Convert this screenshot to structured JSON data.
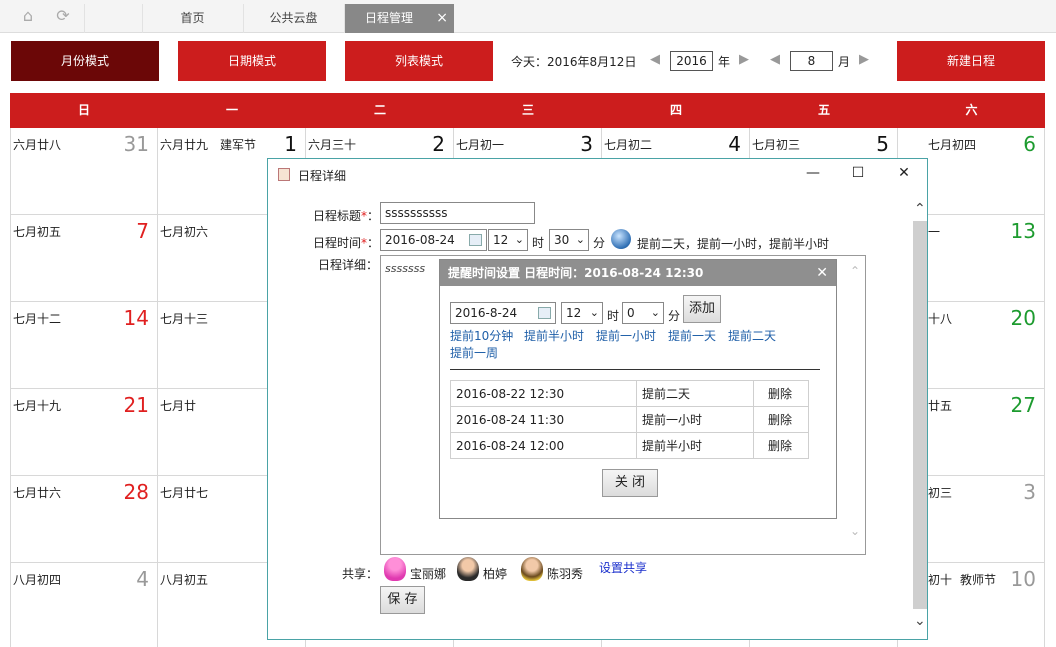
{
  "tabs": {
    "home": "首页",
    "cloud": "公共云盘",
    "schedule": "日程管理",
    "close": "×"
  },
  "toolbar": {
    "month_mode": "月份模式",
    "date_mode": "日期模式",
    "list_mode": "列表模式",
    "today": "今天：2016年8月12日",
    "year": "2016",
    "year_unit": "年",
    "month": "8",
    "month_unit": "月",
    "new_schedule": "新建日程",
    "prev": "◀",
    "next": "▶"
  },
  "colors": {
    "accent": "#cc1d1d",
    "accent_dark": "#6b0707",
    "weekend_sun": "#e02020",
    "weekend_sat": "#1d9b2f"
  },
  "weekdays": [
    "日",
    "一",
    "二",
    "三",
    "四",
    "五",
    "六"
  ],
  "calendar": {
    "rows": [
      [
        {
          "lunar": "六月廿八",
          "day": "31",
          "fest": "",
          "tone": "gray"
        },
        {
          "lunar": "六月廿九",
          "day": "1",
          "fest": "建军节",
          "tone": "normal"
        },
        {
          "lunar": "六月三十",
          "day": "2",
          "fest": "",
          "tone": "normal"
        },
        {
          "lunar": "七月初一",
          "day": "3",
          "fest": "",
          "tone": "normal"
        },
        {
          "lunar": "七月初二",
          "day": "4",
          "fest": "",
          "tone": "normal"
        },
        {
          "lunar": "七月初三",
          "day": "5",
          "fest": "",
          "tone": "normal"
        },
        {
          "lunar": "七月初四",
          "day": "6",
          "fest": "",
          "tone": "green"
        }
      ],
      [
        {
          "lunar": "七月初五",
          "day": "7",
          "fest": "",
          "tone": "red"
        },
        {
          "lunar": "七月初六",
          "day": "",
          "fest": "",
          "tone": "normal"
        },
        {
          "lunar": "",
          "day": "",
          "fest": "",
          "tone": "normal"
        },
        {
          "lunar": "",
          "day": "",
          "fest": "",
          "tone": "normal"
        },
        {
          "lunar": "",
          "day": "",
          "fest": "",
          "tone": "normal"
        },
        {
          "lunar": "",
          "day": "",
          "fest": "",
          "tone": "normal"
        },
        {
          "lunar": "一",
          "day": "13",
          "fest": "",
          "tone": "green"
        }
      ],
      [
        {
          "lunar": "七月十二",
          "day": "14",
          "fest": "",
          "tone": "red"
        },
        {
          "lunar": "七月十三",
          "day": "",
          "fest": "",
          "tone": "normal"
        },
        {
          "lunar": "",
          "day": "",
          "fest": "",
          "tone": "normal"
        },
        {
          "lunar": "",
          "day": "",
          "fest": "",
          "tone": "normal"
        },
        {
          "lunar": "",
          "day": "",
          "fest": "",
          "tone": "normal"
        },
        {
          "lunar": "",
          "day": "",
          "fest": "",
          "tone": "normal"
        },
        {
          "lunar": "十八",
          "day": "20",
          "fest": "",
          "tone": "green"
        }
      ],
      [
        {
          "lunar": "七月十九",
          "day": "21",
          "fest": "",
          "tone": "red"
        },
        {
          "lunar": "七月廿",
          "day": "",
          "fest": "",
          "tone": "normal"
        },
        {
          "lunar": "",
          "day": "",
          "fest": "",
          "tone": "normal"
        },
        {
          "lunar": "",
          "day": "",
          "fest": "",
          "tone": "normal"
        },
        {
          "lunar": "",
          "day": "",
          "fest": "",
          "tone": "normal"
        },
        {
          "lunar": "",
          "day": "",
          "fest": "",
          "tone": "normal"
        },
        {
          "lunar": "廿五",
          "day": "27",
          "fest": "",
          "tone": "green"
        }
      ],
      [
        {
          "lunar": "七月廿六",
          "day": "28",
          "fest": "",
          "tone": "red"
        },
        {
          "lunar": "七月廿七",
          "day": "",
          "fest": "",
          "tone": "normal"
        },
        {
          "lunar": "",
          "day": "",
          "fest": "",
          "tone": "normal"
        },
        {
          "lunar": "",
          "day": "",
          "fest": "",
          "tone": "normal"
        },
        {
          "lunar": "",
          "day": "",
          "fest": "",
          "tone": "normal"
        },
        {
          "lunar": "",
          "day": "",
          "fest": "",
          "tone": "normal"
        },
        {
          "lunar": "初三",
          "day": "3",
          "fest": "",
          "tone": "gray"
        }
      ],
      [
        {
          "lunar": "八月初四",
          "day": "4",
          "fest": "",
          "tone": "gray"
        },
        {
          "lunar": "八月初五",
          "day": "",
          "fest": "",
          "tone": "normal"
        },
        {
          "lunar": "",
          "day": "",
          "fest": "",
          "tone": "normal"
        },
        {
          "lunar": "",
          "day": "",
          "fest": "",
          "tone": "normal"
        },
        {
          "lunar": "",
          "day": "",
          "fest": "",
          "tone": "normal"
        },
        {
          "lunar": "",
          "day": "",
          "fest": "",
          "tone": "normal"
        },
        {
          "lunar": "初十",
          "day": "10",
          "fest": "教师节",
          "tone": "gray"
        }
      ]
    ]
  },
  "detail_dialog": {
    "title": "日程详细",
    "title_label": "日程标题",
    "title_value": "ssssssssss",
    "time_label": "日程时间",
    "date_value": "2016-08-24",
    "hour": "12",
    "hour_unit": "时",
    "minute": "30",
    "minute_unit": "分",
    "reminder_summary": "提前二天，提前一小时，提前半小时",
    "detail_label": "日程详细：",
    "detail_value": "sssssss",
    "share_label": "共享：",
    "share_people": [
      "宝丽娜",
      "柏婷",
      "陈羽秀"
    ],
    "set_share": "设置共享",
    "save": "保 存",
    "required_mark": "*",
    "colon": "："
  },
  "reminder_dialog": {
    "title": "提醒时间设置 日程时间：2016-08-24 12:30",
    "date_value": "2016-8-24",
    "hour": "12",
    "hour_unit": "时",
    "minute": "0",
    "minute_unit": "分",
    "add": "添加",
    "quick": [
      "提前10分钟",
      "提前半小时",
      "提前一小时",
      "提前一天",
      "提前二天",
      "提前一周"
    ],
    "rows": [
      {
        "time": "2016-08-22 12:30",
        "desc": "提前二天",
        "action": "删除"
      },
      {
        "time": "2016-08-24 11:30",
        "desc": "提前一小时",
        "action": "删除"
      },
      {
        "time": "2016-08-24 12:00",
        "desc": "提前半小时",
        "action": "删除"
      }
    ],
    "close": "关 闭"
  }
}
